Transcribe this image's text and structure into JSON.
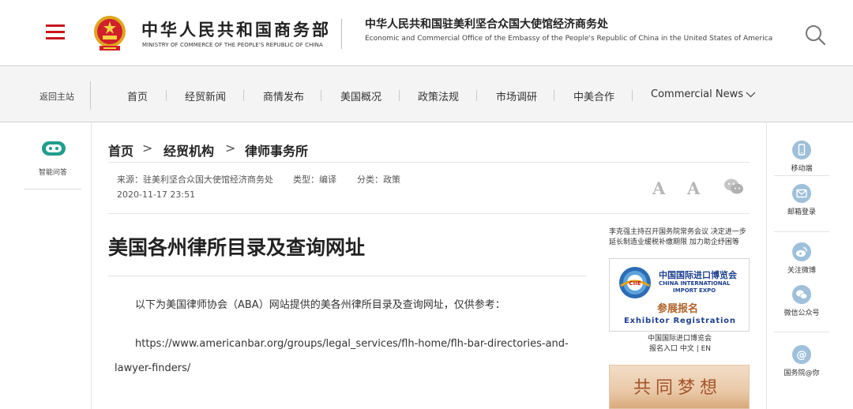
{
  "header": {
    "menu_icon": "hamburger-menu-icon",
    "ministry_cn": "中华人民共和国商务部",
    "ministry_en": "MINISTRY OF COMMERCE OF THE PEOPLE'S REPUBLIC OF CHINA",
    "office_cn": "中华人民共和国驻美利坚合众国大使馆经济商务处",
    "office_en": "Economic and Commercial Office of the Embassy of the People's Republic of China in the United States of America",
    "search_icon": "search-icon",
    "accent_color": "#c8161d"
  },
  "nav": {
    "home_link": "返回主站",
    "items": [
      "首页",
      "经贸新闻",
      "商情发布",
      "美国概况",
      "政策法规",
      "市场调研",
      "中美合作",
      "Commercial News"
    ]
  },
  "left_widget": {
    "label": "智能问答"
  },
  "breadcrumb": [
    "首页",
    "经贸机构",
    "律师事务所"
  ],
  "meta": {
    "source": "来源：驻美利坚合众国大使馆经济商务处",
    "type": "类型：编译",
    "category": "分类：政策",
    "date": "2020-11-17 23:51",
    "font_large": "A",
    "font_small": "A"
  },
  "article": {
    "title": "美国各州律所目录及查询网址",
    "para1": "以下为美国律师协会（ABA）网站提供的美各州律所目录及查询网址，仅供参考：",
    "para2_line1": "https://www.americanbar.org/groups/legal_services/flh-home/flh-bar-directories-and-",
    "para2_line2": "lawyer-finders/"
  },
  "side_ads": {
    "headline_line1": "李克强主持召开国务院常务会议 决定进一步",
    "headline_line2": "延长制造业缓税补缴期限 加力助企纾困等",
    "ciie": {
      "cn": "中国国际进口博览会",
      "en_line1": "CHINA INTERNATIONAL",
      "en_line2": "IMPORT EXPO",
      "reg_cn": "参展报名",
      "reg_en": "Exhibitor Registration",
      "logo_text": "CIIE"
    },
    "ciie_caption_line1": "中国国际进口博览会",
    "ciie_caption_line2": "报名入口 中文 | EN",
    "dream_text": "共同梦想"
  },
  "right_toolbar": [
    {
      "label": "移动端",
      "icon": "mobile-icon"
    },
    {
      "label": "邮箱登录",
      "icon": "mail-icon"
    },
    {
      "label": "关注微博",
      "icon": "weibo-icon"
    },
    {
      "label": "微信公众号",
      "icon": "wechat-icon"
    },
    {
      "label": "国务院@你",
      "icon": "at-icon"
    }
  ]
}
